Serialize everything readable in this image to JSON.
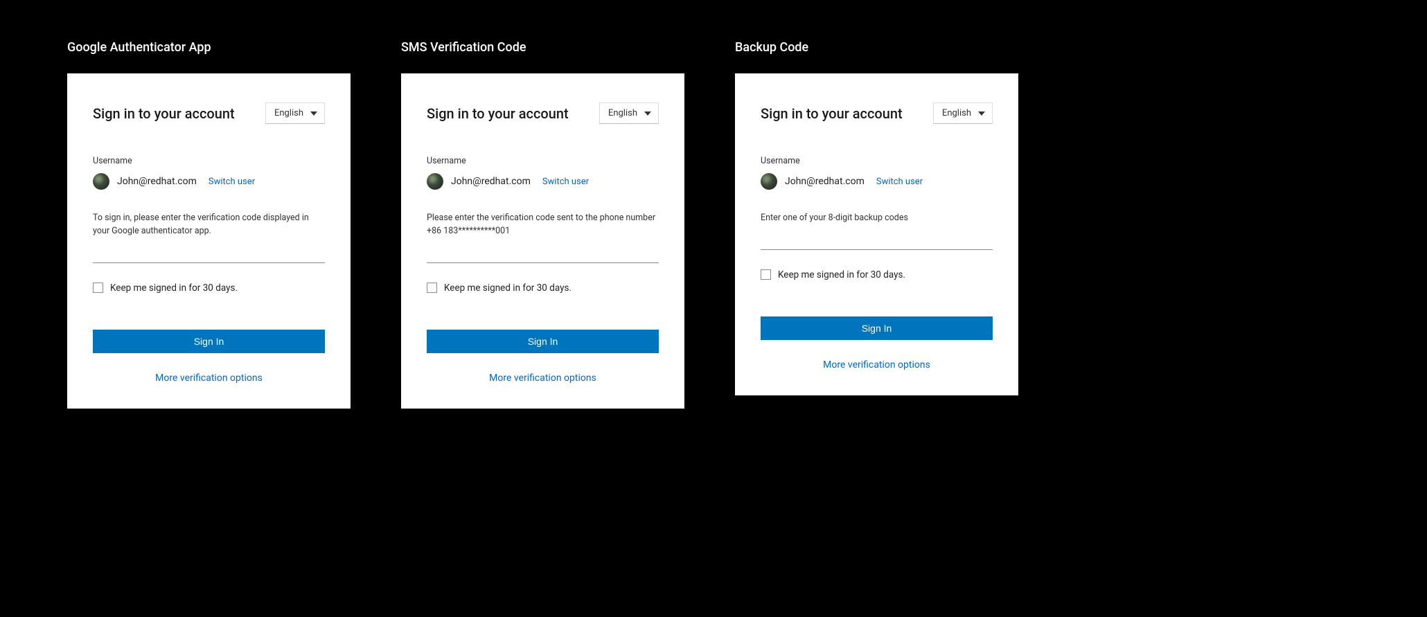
{
  "panels": [
    {
      "title": "Google Authenticator App",
      "card_title": "Sign in to your account",
      "language": "English",
      "username_label": "Username",
      "user_email": "John@redhat.com",
      "switch_user": "Switch user",
      "instruction": "To sign in, please enter the verification code displayed in your Google authenticator app.",
      "keep_signed_label": "Keep me signed in for 30 days.",
      "signin_label": "Sign In",
      "more_options": "More verification options"
    },
    {
      "title": "SMS Verification Code",
      "card_title": "Sign in to your account",
      "language": "English",
      "username_label": "Username",
      "user_email": "John@redhat.com",
      "switch_user": "Switch user",
      "instruction": "Please enter the verification code sent to the phone number +86 183**********001",
      "keep_signed_label": "Keep me signed in for 30 days.",
      "signin_label": "Sign In",
      "more_options": "More verification options"
    },
    {
      "title": "Backup Code",
      "card_title": "Sign in to your account",
      "language": "English",
      "username_label": "Username",
      "user_email": "John@redhat.com",
      "switch_user": "Switch user",
      "instruction": "Enter one of your 8-digit backup codes",
      "keep_signed_label": "Keep me signed in for 30 days.",
      "signin_label": "Sign In",
      "more_options": "More verification options"
    }
  ]
}
